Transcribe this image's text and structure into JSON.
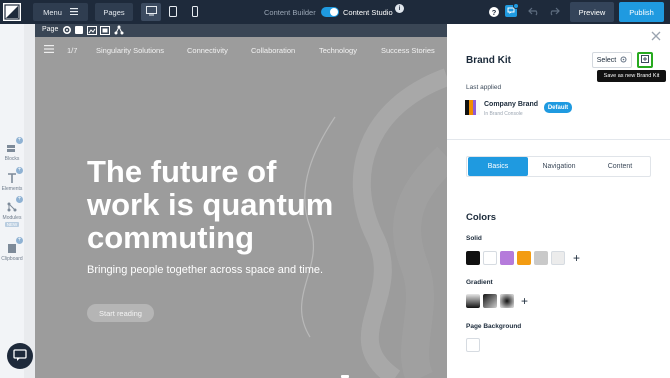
{
  "topbar": {
    "menu_label": "Menu",
    "pages_label": "Pages",
    "content_builder_label": "Content Builder",
    "content_studio_label": "Content Studio",
    "info_glyph": "i",
    "help_glyph": "?",
    "preview_label": "Preview",
    "publish_label": "Publish",
    "devices": [
      "desktop-icon",
      "tablet-icon",
      "mobile-icon"
    ],
    "active_device": "desktop",
    "accent_color": "#1f9ae0"
  },
  "rail": {
    "items": [
      {
        "label": "Blocks",
        "icon": "blocks-icon"
      },
      {
        "label": "Elements",
        "icon": "text-element-icon"
      },
      {
        "label": "Modules",
        "icon": "modules-icon",
        "badge": "NEW"
      },
      {
        "label": "Clipboard",
        "icon": "clipboard-icon"
      }
    ],
    "plus_glyph": "+"
  },
  "pagebar": {
    "label": "Page"
  },
  "canvas": {
    "page_count": "1/7",
    "nav_items": [
      "Singularity Solutions",
      "Connectivity",
      "Collaboration",
      "Technology",
      "Success Stories"
    ],
    "hero_title": "The future of work is quantum commuting",
    "hero_subtitle": "Bringing people together across space and time.",
    "cta_label": "Start reading"
  },
  "panel": {
    "title": "Brand Kit",
    "select_label": "Select",
    "tooltip": "Save as new Brand Kit",
    "last_applied_label": "Last applied",
    "brand_name": "Company Brand",
    "brand_source": "In Brand Console",
    "brand_colors": [
      "#111111",
      "#f08c00",
      "#8e5ad6",
      "#f7f7f7"
    ],
    "default_label": "Default",
    "tabs": [
      "Basics",
      "Navigation",
      "Content"
    ],
    "active_tab": "Basics",
    "colors_title": "Colors",
    "solid_label": "Solid",
    "solid_colors": [
      "#111111",
      "#ffffff",
      "#b57bdb",
      "#f39c12",
      "#c9c9c9",
      "#ececec"
    ],
    "gradient_label": "Gradient",
    "page_background_label": "Page Background",
    "add_glyph": "+"
  }
}
